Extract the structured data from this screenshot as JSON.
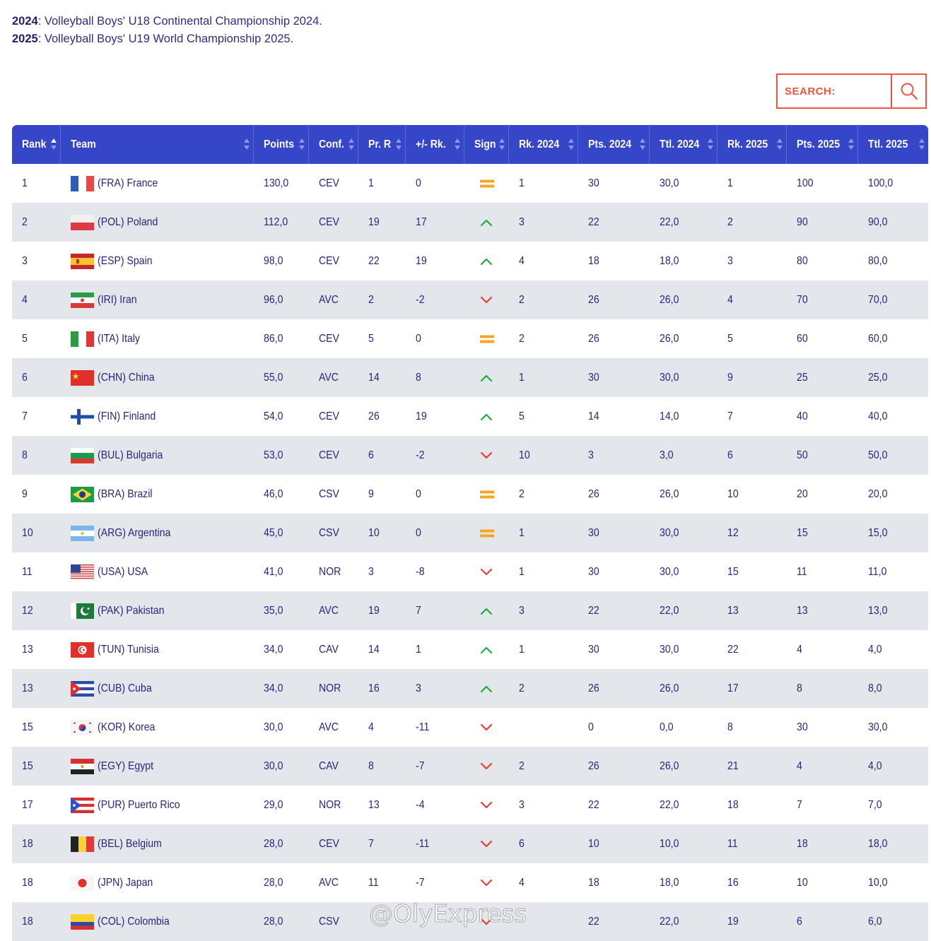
{
  "notes": [
    {
      "year": "2024",
      "text": ": Volleyball Boys' U18 Continental Championship 2024."
    },
    {
      "year": "2025",
      "text": ": Volleyball Boys' U19 World Championship 2025."
    }
  ],
  "search": {
    "label": "SEARCH:",
    "icon": "search-icon"
  },
  "columns": [
    "Rank",
    "Team",
    "Points",
    "Conf.",
    "Pr. R",
    "+/- Rk.",
    "Sign",
    "Rk. 2024",
    "Pts. 2024",
    "Ttl. 2024",
    "Rk. 2025",
    "Pts. 2025",
    "Ttl. 2025"
  ],
  "rows": [
    {
      "rank": "1",
      "team": "(FRA) France",
      "flag": "fra",
      "points": "130,0",
      "conf": "CEV",
      "prr": "1",
      "delta": "0",
      "sign": "equal",
      "rk24": "1",
      "pts24": "30",
      "ttl24": "30,0",
      "rk25": "1",
      "pts25": "100",
      "ttl25": "100,0"
    },
    {
      "rank": "2",
      "team": "(POL) Poland",
      "flag": "pol",
      "points": "112,0",
      "conf": "CEV",
      "prr": "19",
      "delta": "17",
      "sign": "up",
      "rk24": "3",
      "pts24": "22",
      "ttl24": "22,0",
      "rk25": "2",
      "pts25": "90",
      "ttl25": "90,0"
    },
    {
      "rank": "3",
      "team": "(ESP) Spain",
      "flag": "esp",
      "points": "98,0",
      "conf": "CEV",
      "prr": "22",
      "delta": "19",
      "sign": "up",
      "rk24": "4",
      "pts24": "18",
      "ttl24": "18,0",
      "rk25": "3",
      "pts25": "80",
      "ttl25": "80,0"
    },
    {
      "rank": "4",
      "team": "(IRI) Iran",
      "flag": "iri",
      "points": "96,0",
      "conf": "AVC",
      "prr": "2",
      "delta": "-2",
      "sign": "down",
      "rk24": "2",
      "pts24": "26",
      "ttl24": "26,0",
      "rk25": "4",
      "pts25": "70",
      "ttl25": "70,0"
    },
    {
      "rank": "5",
      "team": "(ITA) Italy",
      "flag": "ita",
      "points": "86,0",
      "conf": "CEV",
      "prr": "5",
      "delta": "0",
      "sign": "equal",
      "rk24": "2",
      "pts24": "26",
      "ttl24": "26,0",
      "rk25": "5",
      "pts25": "60",
      "ttl25": "60,0"
    },
    {
      "rank": "6",
      "team": "(CHN) China",
      "flag": "chn",
      "points": "55,0",
      "conf": "AVC",
      "prr": "14",
      "delta": "8",
      "sign": "up",
      "rk24": "1",
      "pts24": "30",
      "ttl24": "30,0",
      "rk25": "9",
      "pts25": "25",
      "ttl25": "25,0"
    },
    {
      "rank": "7",
      "team": "(FIN) Finland",
      "flag": "fin",
      "points": "54,0",
      "conf": "CEV",
      "prr": "26",
      "delta": "19",
      "sign": "up",
      "rk24": "5",
      "pts24": "14",
      "ttl24": "14,0",
      "rk25": "7",
      "pts25": "40",
      "ttl25": "40,0"
    },
    {
      "rank": "8",
      "team": "(BUL) Bulgaria",
      "flag": "bul",
      "points": "53,0",
      "conf": "CEV",
      "prr": "6",
      "delta": "-2",
      "sign": "down",
      "rk24": "10",
      "pts24": "3",
      "ttl24": "3,0",
      "rk25": "6",
      "pts25": "50",
      "ttl25": "50,0"
    },
    {
      "rank": "9",
      "team": "(BRA) Brazil",
      "flag": "bra",
      "points": "46,0",
      "conf": "CSV",
      "prr": "9",
      "delta": "0",
      "sign": "equal",
      "rk24": "2",
      "pts24": "26",
      "ttl24": "26,0",
      "rk25": "10",
      "pts25": "20",
      "ttl25": "20,0"
    },
    {
      "rank": "10",
      "team": "(ARG) Argentina",
      "flag": "arg",
      "points": "45,0",
      "conf": "CSV",
      "prr": "10",
      "delta": "0",
      "sign": "equal",
      "rk24": "1",
      "pts24": "30",
      "ttl24": "30,0",
      "rk25": "12",
      "pts25": "15",
      "ttl25": "15,0"
    },
    {
      "rank": "11",
      "team": "(USA) USA",
      "flag": "usa",
      "points": "41,0",
      "conf": "NOR",
      "prr": "3",
      "delta": "-8",
      "sign": "down",
      "rk24": "1",
      "pts24": "30",
      "ttl24": "30,0",
      "rk25": "15",
      "pts25": "11",
      "ttl25": "11,0"
    },
    {
      "rank": "12",
      "team": "(PAK) Pakistan",
      "flag": "pak",
      "points": "35,0",
      "conf": "AVC",
      "prr": "19",
      "delta": "7",
      "sign": "up",
      "rk24": "3",
      "pts24": "22",
      "ttl24": "22,0",
      "rk25": "13",
      "pts25": "13",
      "ttl25": "13,0"
    },
    {
      "rank": "13",
      "team": "(TUN) Tunisia",
      "flag": "tun",
      "points": "34,0",
      "conf": "CAV",
      "prr": "14",
      "delta": "1",
      "sign": "up",
      "rk24": "1",
      "pts24": "30",
      "ttl24": "30,0",
      "rk25": "22",
      "pts25": "4",
      "ttl25": "4,0"
    },
    {
      "rank": "13",
      "team": "(CUB) Cuba",
      "flag": "cub",
      "points": "34,0",
      "conf": "NOR",
      "prr": "16",
      "delta": "3",
      "sign": "up",
      "rk24": "2",
      "pts24": "26",
      "ttl24": "26,0",
      "rk25": "17",
      "pts25": "8",
      "ttl25": "8,0"
    },
    {
      "rank": "15",
      "team": "(KOR) Korea",
      "flag": "kor",
      "points": "30,0",
      "conf": "AVC",
      "prr": "4",
      "delta": "-11",
      "sign": "down",
      "rk24": "",
      "pts24": "0",
      "ttl24": "0,0",
      "rk25": "8",
      "pts25": "30",
      "ttl25": "30,0"
    },
    {
      "rank": "15",
      "team": "(EGY) Egypt",
      "flag": "egy",
      "points": "30,0",
      "conf": "CAV",
      "prr": "8",
      "delta": "-7",
      "sign": "down",
      "rk24": "2",
      "pts24": "26",
      "ttl24": "26,0",
      "rk25": "21",
      "pts25": "4",
      "ttl25": "4,0"
    },
    {
      "rank": "17",
      "team": "(PUR) Puerto Rico",
      "flag": "pur",
      "points": "29,0",
      "conf": "NOR",
      "prr": "13",
      "delta": "-4",
      "sign": "down",
      "rk24": "3",
      "pts24": "22",
      "ttl24": "22,0",
      "rk25": "18",
      "pts25": "7",
      "ttl25": "7,0"
    },
    {
      "rank": "18",
      "team": "(BEL) Belgium",
      "flag": "bel",
      "points": "28,0",
      "conf": "CEV",
      "prr": "7",
      "delta": "-11",
      "sign": "down",
      "rk24": "6",
      "pts24": "10",
      "ttl24": "10,0",
      "rk25": "11",
      "pts25": "18",
      "ttl25": "18,0"
    },
    {
      "rank": "18",
      "team": "(JPN) Japan",
      "flag": "jpn",
      "points": "28,0",
      "conf": "AVC",
      "prr": "11",
      "delta": "-7",
      "sign": "down",
      "rk24": "4",
      "pts24": "18",
      "ttl24": "18,0",
      "rk25": "16",
      "pts25": "10",
      "ttl25": "10,0"
    },
    {
      "rank": "18",
      "team": "(COL) Colombia",
      "flag": "col",
      "points": "28,0",
      "conf": "CSV",
      "prr": "",
      "delta": "",
      "sign": "down",
      "rk24": "",
      "pts24": "22",
      "ttl24": "22,0",
      "rk25": "19",
      "pts25": "6",
      "ttl25": "6,0"
    }
  ],
  "watermark": "@OlyExpress",
  "colors": {
    "header": "#3646c8",
    "accent": "#f0533f",
    "up": "#1faa3c",
    "down": "#e8402c",
    "equal": "#f5a623",
    "row_alt": "#e3e6ea"
  }
}
